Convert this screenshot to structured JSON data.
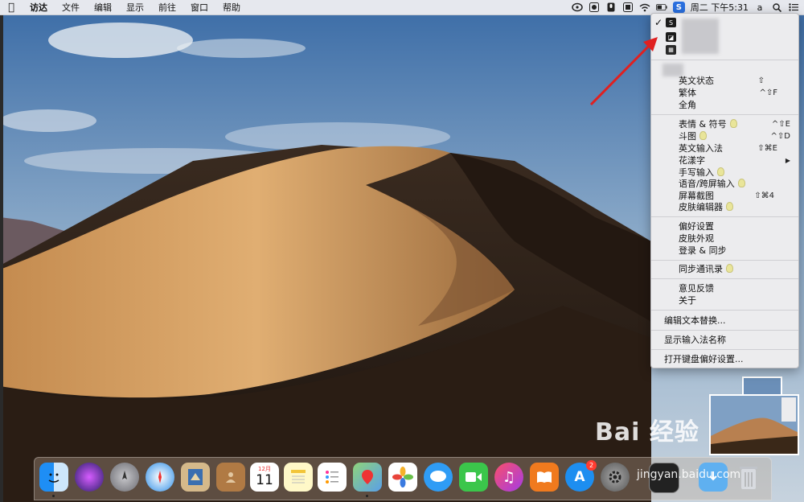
{
  "menubar": {
    "app_menus": [
      "访达",
      "文件",
      "编辑",
      "显示",
      "前往",
      "窗口",
      "帮助"
    ],
    "clock": "周二 下午5:31",
    "input_letter": "a"
  },
  "ime_menu": {
    "items_top": [
      {
        "label": "英文状态",
        "shortcut": "⇧"
      },
      {
        "label": "繁体",
        "shortcut": "^⇧F"
      },
      {
        "label": "全角",
        "shortcut": ""
      }
    ],
    "items_tools": [
      {
        "label": "表情 & 符号",
        "shortcut": "^⇧E",
        "bulb": true
      },
      {
        "label": "斗图",
        "shortcut": "^⇧D",
        "bulb": true
      },
      {
        "label": "英文输入法",
        "shortcut": "⇧⌘E",
        "bulb": false
      },
      {
        "label": "花漾字",
        "shortcut": "▶",
        "bulb": false
      },
      {
        "label": "手写输入",
        "shortcut": "",
        "bulb": true
      },
      {
        "label": "语音/跨屏输入",
        "shortcut": "",
        "bulb": true
      },
      {
        "label": "屏幕截图",
        "shortcut": "⇧⌘4",
        "bulb": false
      },
      {
        "label": "皮肤编辑器",
        "shortcut": "",
        "bulb": true
      }
    ],
    "items_prefs": [
      {
        "label": "偏好设置"
      },
      {
        "label": "皮肤外观"
      },
      {
        "label": "登录 & 同步"
      }
    ],
    "item_sync": "同步通讯录",
    "items_about": [
      {
        "label": "意见反馈"
      },
      {
        "label": "关于"
      }
    ],
    "edit_text_replace": "编辑文本替换...",
    "show_ime_name": "显示输入法名称",
    "open_keyboard_prefs": "打开键盘偏好设置..."
  },
  "dock": {
    "calendar_month": "12月",
    "calendar_day": "11",
    "appstore_badge": "2"
  },
  "watermark": {
    "brand": "Bai  经验",
    "url": "jingyan.baidu.com"
  }
}
